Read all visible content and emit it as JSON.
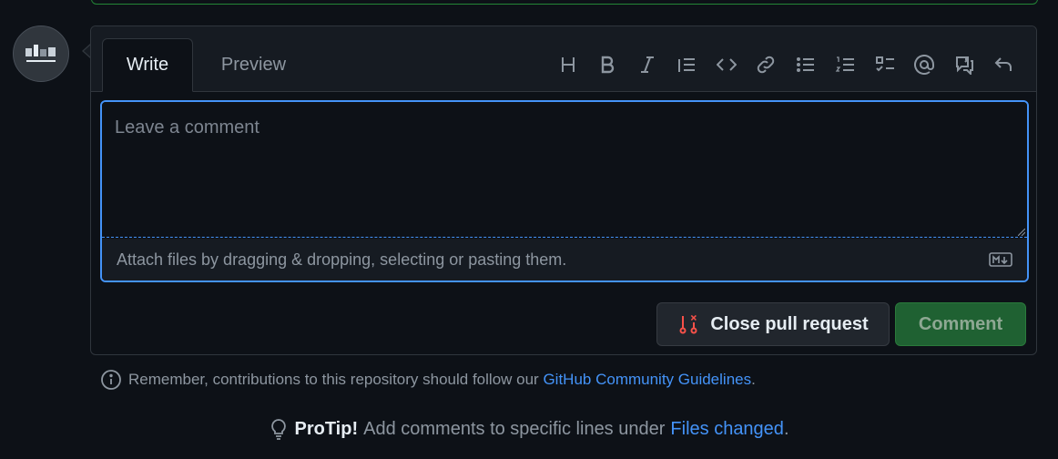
{
  "avatar": {
    "alt": "user avatar"
  },
  "editor": {
    "tabs": [
      {
        "label": "Write"
      },
      {
        "label": "Preview"
      }
    ],
    "toolbar_icons": [
      "heading-icon",
      "bold-icon",
      "italic-icon",
      "quote-icon",
      "code-icon",
      "link-icon",
      "unordered-list-icon",
      "ordered-list-icon",
      "task-list-icon",
      "mention-icon",
      "reference-icon",
      "undo-icon"
    ],
    "placeholder": "Leave a comment",
    "attach_text": "Attach files by dragging & dropping, selecting or pasting them.",
    "markdown_icon": "markdown-icon"
  },
  "actions": {
    "close_pr_label": "Close pull request",
    "comment_label": "Comment"
  },
  "guidelines": {
    "prefix": "Remember, contributions to this repository should follow our",
    "link": "GitHub Community Guidelines",
    "suffix": "."
  },
  "protip": {
    "label": "ProTip!",
    "text": "Add comments to specific lines under",
    "link": "Files changed",
    "suffix": "."
  },
  "colors": {
    "accent": "#4493f8",
    "close_pr_icon": "#f85149",
    "comment_button": "#238636"
  }
}
